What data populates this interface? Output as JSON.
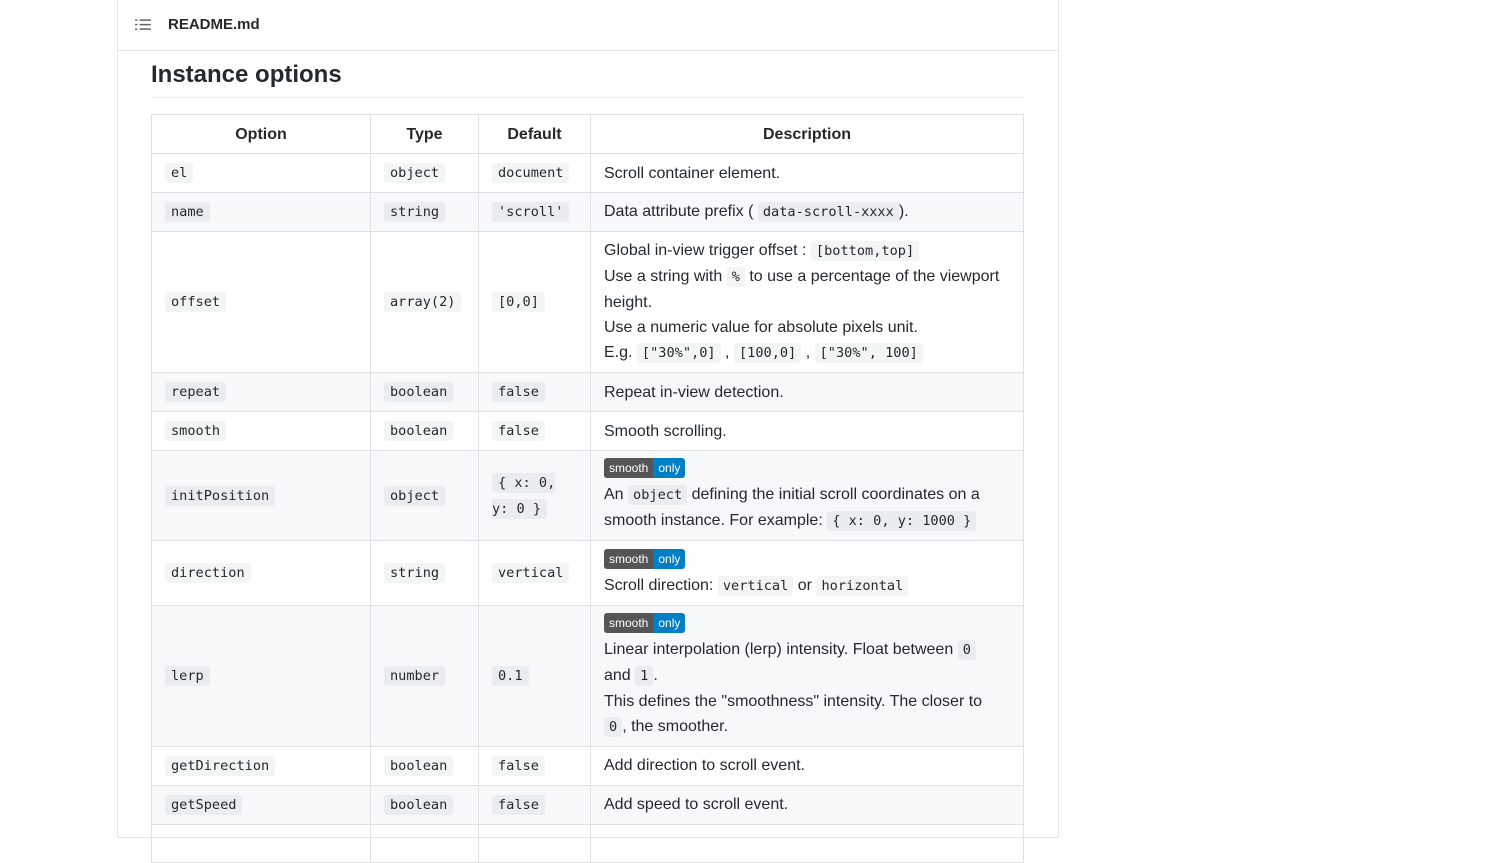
{
  "readme": {
    "filename": "README.md",
    "icon": "list-unordered-icon"
  },
  "section": {
    "title": "Instance options"
  },
  "table": {
    "headers": [
      "Option",
      "Type",
      "Default",
      "Description"
    ],
    "badge": {
      "left": "smooth",
      "right": "only",
      "left_color": "#555555",
      "right_color": "#007ec6"
    },
    "rows": [
      {
        "option": "el",
        "type": "object",
        "default": "document",
        "desc": [
          "Scroll container element."
        ]
      },
      {
        "option": "name",
        "type": "string",
        "default": "'scroll'",
        "desc": [
          "Data attribute prefix (",
          "data-scroll-xxxx",
          ")."
        ]
      },
      {
        "option": "offset",
        "type": "array(2)",
        "default": "[0,0]",
        "desc": [
          "Global in-view trigger offset :",
          "[bottom,top]",
          "Use a string with",
          "%",
          "to use a percentage of the viewport height.",
          "Use a numeric value for absolute pixels unit.",
          "E.g.",
          "[\"30%\",0]",
          ",",
          "[100,0]",
          ",",
          "[\"30%\", 100]"
        ]
      },
      {
        "option": "repeat",
        "type": "boolean",
        "default": "false",
        "desc": [
          "Repeat in-view detection."
        ]
      },
      {
        "option": "smooth",
        "type": "boolean",
        "default": "false",
        "desc": [
          "Smooth scrolling."
        ]
      },
      {
        "option": "initPosition",
        "type": "object",
        "default": "{ x: 0, y: 0 }",
        "desc": [
          "An",
          "object",
          "defining the initial scroll coordinates on a smooth instance. For example:",
          "{ x: 0, y: 1000 }"
        ]
      },
      {
        "option": "direction",
        "type": "string",
        "default": "vertical",
        "desc": [
          "Scroll direction:",
          "vertical",
          "or",
          "horizontal"
        ]
      },
      {
        "option": "lerp",
        "type": "number",
        "default": "0.1",
        "desc": [
          "Linear interpolation (lerp) intensity. Float between",
          "0",
          "and",
          "1",
          ".",
          "This defines the \"smoothness\" intensity. The closer to",
          "0",
          ", the smoother."
        ]
      },
      {
        "option": "getDirection",
        "type": "boolean",
        "default": "false",
        "desc": [
          "Add direction to scroll event."
        ]
      },
      {
        "option": "getSpeed",
        "type": "boolean",
        "default": "false",
        "desc": [
          "Add speed to scroll event."
        ]
      }
    ]
  }
}
